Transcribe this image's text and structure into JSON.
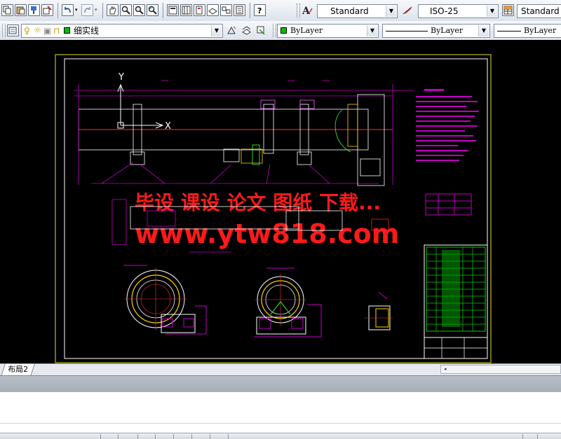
{
  "toolbar_top": {
    "text_style_value": "Standard",
    "dim_style_value": "ISO-25",
    "table_style_value": "Standard"
  },
  "toolbar_layers": {
    "layer_value": "细实线",
    "color_value": "ByLayer",
    "linetype_value": "ByLayer",
    "lineweight_value": "ByLayer",
    "colors": {
      "layer_swatch": "#00c000",
      "color_swatch": "#00c000"
    }
  },
  "drawing": {
    "axis_y_label": "Y",
    "axis_x_label": "X",
    "watermark_line1": "毕设 课设 论文 图纸 下载...",
    "watermark_line2": "www.ytw818.com",
    "colors": {
      "background": "#000000",
      "frame": "#ffffff",
      "dimension": "#c000c0",
      "watermark": "#ff1a1a"
    }
  },
  "layout_tabs": {
    "tab_label": "布局2"
  }
}
